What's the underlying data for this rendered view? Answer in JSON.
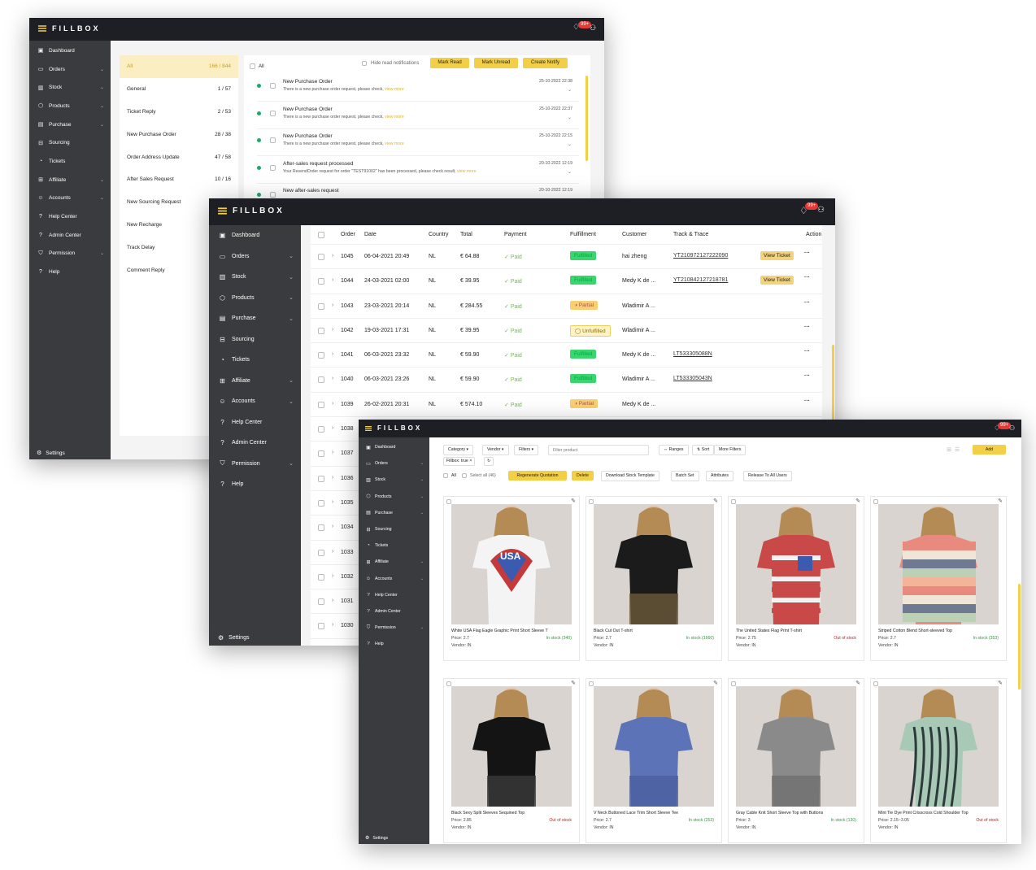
{
  "brand": "FILLBOX",
  "badge": "99+",
  "settings_label": "Settings",
  "nav_w1": [
    {
      "label": "Dashboard",
      "icon": "dashboard-icon",
      "sym": "▣",
      "chev": false
    },
    {
      "label": "Orders",
      "icon": "orders-icon",
      "sym": "▭",
      "chev": true
    },
    {
      "label": "Stock",
      "icon": "stock-icon",
      "sym": "▥",
      "chev": true
    },
    {
      "label": "Products",
      "icon": "products-icon",
      "sym": "⬡",
      "chev": true
    },
    {
      "label": "Purchase",
      "icon": "purchase-icon",
      "sym": "▤",
      "chev": true
    },
    {
      "label": "Sourcing",
      "icon": "sourcing-icon",
      "sym": "⊟",
      "chev": false
    },
    {
      "label": "Tickets",
      "icon": "tickets-icon",
      "sym": "◔",
      "chev": false
    },
    {
      "label": "Affiliate",
      "icon": "affiliate-icon",
      "sym": "⊞",
      "chev": true
    },
    {
      "label": "Accounts",
      "icon": "accounts-icon",
      "sym": "☺",
      "chev": true
    },
    {
      "label": "Help Center",
      "icon": "help-center-icon",
      "sym": "?",
      "chev": false
    },
    {
      "label": "Admin Center",
      "icon": "admin-center-icon",
      "sym": "?",
      "chev": false
    },
    {
      "label": "Permission",
      "icon": "permission-icon",
      "sym": "⛉",
      "chev": true
    },
    {
      "label": "Help",
      "icon": "help-icon",
      "sym": "?",
      "chev": false
    }
  ],
  "notif_filters": [
    {
      "label": "All",
      "count": "166 / 844",
      "active": true
    },
    {
      "label": "General",
      "count": "1 / 57"
    },
    {
      "label": "Ticket Reply",
      "count": "2 / 53"
    },
    {
      "label": "New Purchase Order",
      "count": "28 / 38"
    },
    {
      "label": "Order Address Update",
      "count": "47 / 58"
    },
    {
      "label": "After Sales Request",
      "count": "10 / 16"
    },
    {
      "label": "New Sourcing Request",
      "count": ""
    },
    {
      "label": "New Recharge",
      "count": ""
    },
    {
      "label": "Track Delay",
      "count": ""
    },
    {
      "label": "Comment Reply",
      "count": ""
    }
  ],
  "notif_toolbar": {
    "all": "All",
    "hide_read": "Hide read notifications",
    "mark_read": "Mark Read",
    "mark_unread": "Mark Unread",
    "create_notify": "Create Notify"
  },
  "notifications": [
    {
      "title": "New Purchase Order",
      "desc": "There is a new purchase order request, please check,",
      "more": "view more",
      "date": "25-10-2022 22:38"
    },
    {
      "title": "New Purchase Order",
      "desc": "There is a new purchase order request, please check,",
      "more": "view more",
      "date": "25-10-2022 22:37"
    },
    {
      "title": "New Purchase Order",
      "desc": "There is a new purchase order request, please check,",
      "more": "view more",
      "date": "25-10-2022 22:15"
    },
    {
      "title": "After-sales request processed",
      "desc": "Your ResendOrder request for order \"TEST91002\" has been processed, please check result,",
      "more": "view more",
      "date": "20-10-2022 12:19"
    },
    {
      "title": "New after-sales request",
      "desc": "",
      "more": "",
      "date": "20-10-2022 12:19"
    }
  ],
  "orders_headers": [
    "Order",
    "Date",
    "Country",
    "Total",
    "Payment",
    "Fulfillment",
    "Customer",
    "Track & Trace",
    "Action"
  ],
  "orders": [
    {
      "order": "1045",
      "date": "06-04-2021 20:49",
      "country": "NL",
      "total": "€ 64.88",
      "payment": "Paid",
      "ful": "Fulfilled",
      "customer": "hai zheng",
      "track": "YT2109721272220​90",
      "action": "View Ticket"
    },
    {
      "order": "1044",
      "date": "24-03-2021 02:00",
      "country": "NL",
      "total": "€ 39.95",
      "payment": "Paid",
      "ful": "Fulfilled",
      "customer": "Medy K de ...",
      "track": "YT2108421272187​81",
      "action": "View Ticket"
    },
    {
      "order": "1043",
      "date": "23-03-2021 20:14",
      "country": "NL",
      "total": "€ 284.55",
      "payment": "Paid",
      "ful": "Partial",
      "customer": "Wladimir A ...",
      "track": "",
      "action": ""
    },
    {
      "order": "1042",
      "date": "19-03-2021 17:31",
      "country": "NL",
      "total": "€ 39.95",
      "payment": "Paid",
      "ful": "Unfulfilled",
      "customer": "Wladimir A ...",
      "track": "",
      "action": ""
    },
    {
      "order": "1041",
      "date": "06-03-2021 23:32",
      "country": "NL",
      "total": "€ 59.90",
      "payment": "Paid",
      "ful": "Fulfilled",
      "customer": "Medy K de ...",
      "track": "LT533305088N",
      "action": ""
    },
    {
      "order": "1040",
      "date": "06-03-2021 23:26",
      "country": "NL",
      "total": "€ 59.90",
      "payment": "Paid",
      "ful": "Fulfilled",
      "customer": "Wladimir A ...",
      "track": "LT533305043N",
      "action": ""
    },
    {
      "order": "1039",
      "date": "26-02-2021 20:31",
      "country": "NL",
      "total": "€ 574.10",
      "payment": "Paid",
      "ful": "Partial",
      "customer": "Medy K de ...",
      "track": "",
      "action": ""
    },
    {
      "order": "1038"
    },
    {
      "order": "1037"
    },
    {
      "order": "1036"
    },
    {
      "order": "1035"
    },
    {
      "order": "1034"
    },
    {
      "order": "1033"
    },
    {
      "order": "1032"
    },
    {
      "order": "1031"
    },
    {
      "order": "1030"
    }
  ],
  "catalog_toolbar": {
    "category": "Category",
    "vendor": "Vendor",
    "filters": "Filters",
    "filter_placeholder": "Filter product",
    "ranges": "Ranges",
    "sort": "Sort",
    "more_filters": "More Filters",
    "add": "Add",
    "tag": "Fillbox: true",
    "all": "All",
    "select_all": "Select all (46)",
    "regen": "Regenerate Quotation",
    "delete": "Delete",
    "download": "Download Stock Template",
    "batch": "Batch Set",
    "attributes": "Attributes",
    "release": "Release To All Users"
  },
  "products": [
    {
      "name": "White USA Flag Eagle Graphic Print Short Sleeve T",
      "price": "Price: 2.7",
      "vendor": "Vendor: IN",
      "stock": "In stock (340)",
      "in": true,
      "kind": "usa",
      "c1": "#f4f4f4",
      "c2": "#3b5bb0"
    },
    {
      "name": "Black Cut Out T-shirt",
      "price": "Price: 2.7",
      "vendor": "Vendor: IN",
      "stock": "In stock (1660)",
      "in": true,
      "kind": "plain",
      "c1": "#1b1b1b",
      "c2": "#6b5a3a"
    },
    {
      "name": "The United States Flag Print T-shirt",
      "price": "Price: 2.75",
      "vendor": "Vendor: IN",
      "stock": "Out of stock",
      "in": false,
      "kind": "flag",
      "c1": "#c94848",
      "c2": "#f3f3f3"
    },
    {
      "name": "Striped Cotton Blend Short-sleeved Top",
      "price": "Price: 2.7",
      "vendor": "Vendor: IN",
      "stock": "In stock (353)",
      "in": true,
      "kind": "stripe",
      "c1": "#e98a7f",
      "c2": "#6f7a92"
    },
    {
      "name": "Black Sexy Split Sleeves Sequined Top",
      "price": "Price: 2.85",
      "vendor": "Vendor: IN",
      "stock": "Out of stock",
      "in": false,
      "kind": "plain",
      "c1": "#141414",
      "c2": "#3a3a3a"
    },
    {
      "name": "V Neck Buttoned Lace Trim Short Sleeve Tee",
      "price": "Price: 2.7",
      "vendor": "Vendor: IN",
      "stock": "In stock (253)",
      "in": true,
      "kind": "plain",
      "c1": "#5c73b8",
      "c2": "#4a5f9e"
    },
    {
      "name": "Gray Cable Knit Short Sleeve Top with Buttons",
      "price": "Price: 3",
      "vendor": "Vendor: IN",
      "stock": "In stock (130)",
      "in": true,
      "kind": "plain",
      "c1": "#8a8a8a",
      "c2": "#6f6f6f"
    },
    {
      "name": "Mint Tie Dye Print Crisscross Cold Shoulder Top",
      "price": "Price: 2.15~3.05",
      "vendor": "Vendor: IN",
      "stock": "Out of stock",
      "in": false,
      "kind": "tie",
      "c1": "#a9c9b7",
      "c2": "#2c3a3a"
    }
  ]
}
